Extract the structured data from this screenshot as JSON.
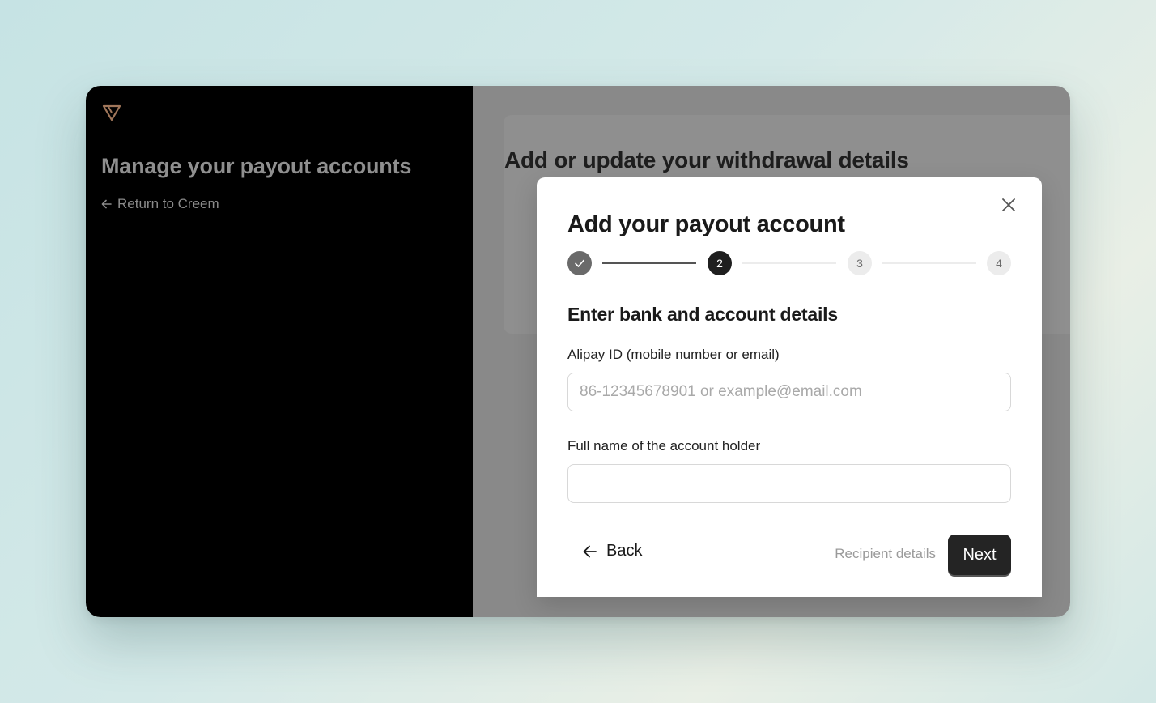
{
  "sidebar": {
    "logo_icon": "triangle-logo-icon",
    "title": "Manage your payout accounts",
    "return_link": "Return to Creem",
    "return_icon": "arrow-left-icon"
  },
  "main": {
    "card_title": "Add or update your withdrawal details"
  },
  "modal": {
    "title": "Add your payout account",
    "close_icon": "close-icon",
    "steps": [
      {
        "label": "✓",
        "state": "done"
      },
      {
        "label": "2",
        "state": "active"
      },
      {
        "label": "3",
        "state": "pending"
      },
      {
        "label": "4",
        "state": "pending"
      }
    ],
    "section_title": "Enter bank and account details",
    "fields": [
      {
        "label": "Alipay ID (mobile number or email)",
        "placeholder": "86-12345678901 or example@email.com",
        "value": ""
      },
      {
        "label": "Full name of the account holder",
        "placeholder": "",
        "value": ""
      }
    ],
    "back_label": "Back",
    "next_caption": "Recipient details",
    "next_label": "Next"
  },
  "colors": {
    "accent": "#242424",
    "logo": "#a0765a",
    "sidebar_bg": "#000000",
    "overlay_bg": "#898989"
  }
}
